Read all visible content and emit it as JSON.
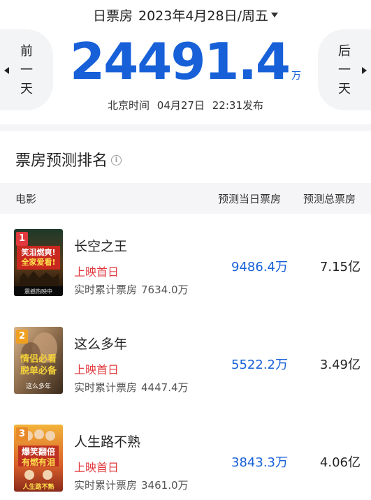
{
  "header": {
    "date_label": "日票房",
    "date_value": "2023年4月28日/周五",
    "prev_day": [
      "前",
      "一",
      "天"
    ],
    "next_day": [
      "后",
      "一",
      "天"
    ],
    "big_value": "24491.4",
    "big_unit": "万",
    "publish": {
      "prefix": "北京时间",
      "date": "04月27日",
      "time": "22:31发布"
    }
  },
  "section": {
    "title": "票房预测排名"
  },
  "table": {
    "headers": [
      "电影",
      "预测当日票房",
      "预测总票房"
    ],
    "rows": [
      {
        "rank": "1",
        "name": "长空之王",
        "tag": "上映首日",
        "realtime_label": "实时累计票房",
        "realtime_value": "7634.0万",
        "pred_day": "9486.4万",
        "pred_total": "7.15亿",
        "poster_text": [
          "笑泪燃爽!",
          "全家爱看!"
        ],
        "poster_footer": "震撼热映中",
        "rank_color": "#e0393e"
      },
      {
        "rank": "2",
        "name": "这么多年",
        "tag": "上映首日",
        "realtime_label": "实时累计票房",
        "realtime_value": "4447.4万",
        "pred_day": "5522.2万",
        "pred_total": "3.49亿",
        "poster_text": [
          "情侣必看",
          "脱单必备"
        ],
        "poster_footer": "这么多年",
        "rank_color": "#f0a020"
      },
      {
        "rank": "3",
        "name": "人生路不熟",
        "tag": "上映首日",
        "realtime_label": "实时累计票房",
        "realtime_value": "3461.0万",
        "pred_day": "3843.3万",
        "pred_total": "4.06亿",
        "poster_text": [
          "爆笑翻倍",
          "有燃有泪"
        ],
        "poster_footer": "人生路不熟",
        "rank_color": "#e88a2a"
      }
    ]
  },
  "colors": {
    "accent": "#1760d8",
    "tag_red": "#e0393e"
  }
}
